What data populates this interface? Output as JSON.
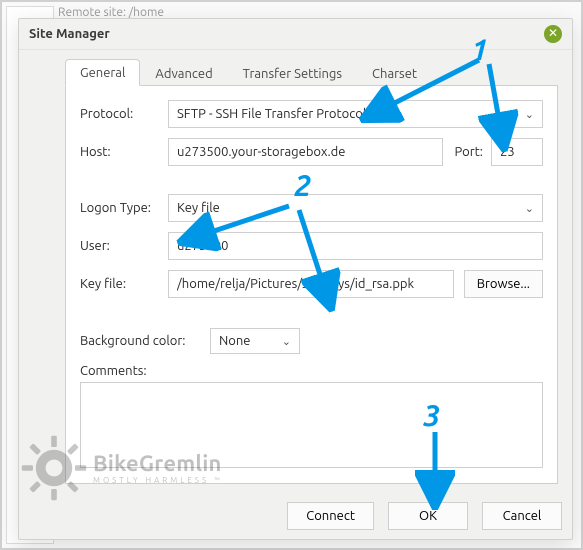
{
  "dialog": {
    "title": "Site Manager"
  },
  "bg": {
    "top_text": "Remote site:   /home"
  },
  "tabs": [
    "General",
    "Advanced",
    "Transfer Settings",
    "Charset"
  ],
  "form": {
    "protocol_label": "Protocol:",
    "protocol_value": "SFTP - SSH File Transfer Protocol",
    "host_label": "Host:",
    "host_value": "u273500.your-storagebox.de",
    "port_label": "Port:",
    "port_value": "23",
    "logon_label": "Logon Type:",
    "logon_value": "Key file",
    "user_label": "User:",
    "user_value": "u273500",
    "keyfile_label": "Key file:",
    "keyfile_value": "/home/relja/Pictures/ssh-keys/id_rsa.ppk",
    "browse_label": "Browse...",
    "bgcolor_label": "Background color:",
    "bgcolor_value": "None",
    "comments_label": "Comments:",
    "comments_value": ""
  },
  "buttons": {
    "connect": "Connect",
    "ok": "OK",
    "cancel": "Cancel"
  },
  "annotations": {
    "n1": "1",
    "n2": "2",
    "n3": "3"
  },
  "watermark": {
    "main": "BikeGremlin",
    "sub": "MOSTLY HARMLESS ™"
  }
}
